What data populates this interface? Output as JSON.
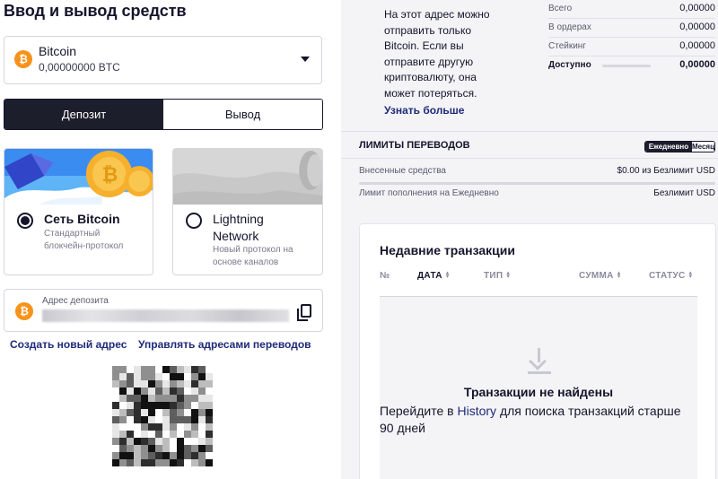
{
  "page": {
    "title": "Ввод и вывод средств"
  },
  "asset": {
    "name": "Bitcoin",
    "balance": "0,00000000 BTC",
    "icon": "bitcoin-icon",
    "color": "#f7931a"
  },
  "tabs": [
    {
      "label": "Депозит",
      "active": true
    },
    {
      "label": "Вывод",
      "active": false
    }
  ],
  "networks": [
    {
      "title": "Сеть Bitcoin",
      "desc_line1": "Стандартный",
      "desc_line2": "блокчейн-протокол",
      "selected": true
    },
    {
      "title_line1": "Lightning",
      "title_line2": "Network",
      "desc_line1": "Новый протокол на",
      "desc_line2": "основе каналов",
      "selected": false
    }
  ],
  "deposit_address": {
    "label": "Адрес депозита",
    "copy_icon": "copy-icon"
  },
  "links": {
    "new_address": "Создать новый адрес",
    "manage_addresses": "Управлять адресами переводов"
  },
  "warning": {
    "lines": [
      "На этот адрес можно",
      "отправить только",
      "Bitcoin. Если вы",
      "отправите другую",
      "криптовалюту, она",
      "может потеряться."
    ],
    "learn_more": "Узнать больше"
  },
  "balances": [
    {
      "label": "Всего",
      "value": "0,00000"
    },
    {
      "label": "В ордерах",
      "value": "0,00000"
    },
    {
      "label": "Стейкинг",
      "value": "0,00000"
    },
    {
      "label": "Доступно",
      "value": "0,00000"
    }
  ],
  "limits": {
    "title": "ЛИМИТЫ ПЕРЕВОДОВ",
    "toggle": {
      "daily": "Ежедневно",
      "monthly": "Месяц"
    },
    "rows": [
      {
        "label": "Внесенные средства",
        "value": "$0.00 из Безлимит USD"
      },
      {
        "label": "Лимит пополнения на Ежедневно",
        "value": "Безлимит USD"
      }
    ]
  },
  "transactions": {
    "title": "Недавние транзакции",
    "columns": [
      "№",
      "ДАТА",
      "ТИП",
      "СУММА",
      "СТАТУС"
    ],
    "empty_title": "Транзакции не найдены",
    "empty_prefix": "Перейдите в ",
    "empty_link": "History",
    "empty_suffix": " для поиска транзакций старше 90 дней"
  }
}
